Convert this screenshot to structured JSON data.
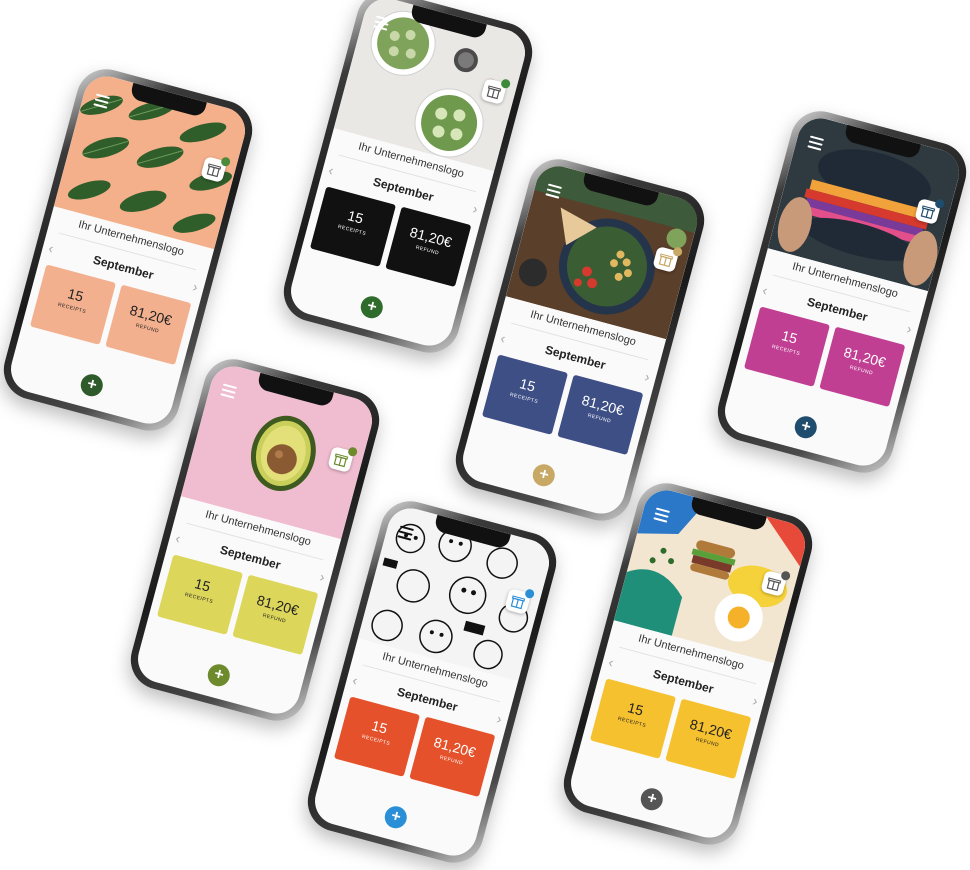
{
  "phones": [
    {
      "id": "kale",
      "hero": "kale-leaves-on-peach",
      "logo_text": "Ihr Unternehmenslogo",
      "month": "September",
      "receipts_value": "15",
      "receipts_label": "RECEIPTS",
      "refund_value": "81,20€",
      "refund_label": "REFUND",
      "tile_color": "#f2b08e",
      "tile_text_color": "#222222",
      "add_button_color": "#2f5a2a",
      "badge_color": "#4b8a3a",
      "add_icon": "plus-icon",
      "prev_icon": "chevron-left-icon",
      "next_icon": "chevron-right-icon",
      "menu_icon": "menu-icon",
      "gift_icon": "gift-icon"
    },
    {
      "id": "salad-bowls",
      "hero": "cucumber-salad-bowls",
      "logo_text": "Ihr Unternehmenslogo",
      "month": "September",
      "receipts_value": "15",
      "receipts_label": "RECEIPTS",
      "refund_value": "81,20€",
      "refund_label": "REFUND",
      "tile_color": "#111111",
      "tile_text_color": "#ffffff",
      "add_button_color": "#2f6b2a",
      "badge_color": "#3e8a3a",
      "add_icon": "plus-icon",
      "prev_icon": "chevron-left-icon",
      "next_icon": "chevron-right-icon",
      "menu_icon": "menu-icon",
      "gift_icon": "gift-icon"
    },
    {
      "id": "chickpea-bowl",
      "hero": "chickpea-salad-bowl",
      "logo_text": "Ihr Unternehmenslogo",
      "month": "September",
      "receipts_value": "15",
      "receipts_label": "RECEIPTS",
      "refund_value": "81,20€",
      "refund_label": "REFUND",
      "tile_color": "#3e4f86",
      "tile_text_color": "#ffffff",
      "add_button_color": "#c7a865",
      "badge_color": "#c7a865",
      "add_icon": "plus-icon",
      "prev_icon": "chevron-left-icon",
      "next_icon": "chevron-right-icon",
      "menu_icon": "menu-icon",
      "gift_icon": "gift-icon"
    },
    {
      "id": "burger",
      "hero": "black-bun-burger",
      "logo_text": "Ihr Unternehmenslogo",
      "month": "September",
      "receipts_value": "15",
      "receipts_label": "RECEIPTS",
      "refund_value": "81,20€",
      "refund_label": "REFUND",
      "tile_color": "#c13f93",
      "tile_text_color": "#ffffff",
      "add_button_color": "#1f4d6e",
      "badge_color": "#1f4d6e",
      "add_icon": "plus-icon",
      "prev_icon": "chevron-left-icon",
      "next_icon": "chevron-right-icon",
      "menu_icon": "menu-icon",
      "gift_icon": "gift-icon"
    },
    {
      "id": "avocado",
      "hero": "avocado-on-pink",
      "logo_text": "Ihr Unternehmenslogo",
      "month": "September",
      "receipts_value": "15",
      "receipts_label": "RECEIPTS",
      "refund_value": "81,20€",
      "refund_label": "REFUND",
      "tile_color": "#dcd65a",
      "tile_text_color": "#222222",
      "add_button_color": "#6d8a2c",
      "badge_color": "#6d8a2c",
      "add_icon": "plus-icon",
      "prev_icon": "chevron-left-icon",
      "next_icon": "chevron-right-icon",
      "menu_icon": "menu-icon",
      "gift_icon": "gift-icon"
    },
    {
      "id": "doodle",
      "hero": "black-white-doodle",
      "logo_text": "Ihr Unternehmenslogo",
      "month": "September",
      "receipts_value": "15",
      "receipts_label": "RECEIPTS",
      "refund_value": "81,20€",
      "refund_label": "REFUND",
      "tile_color": "#e4512a",
      "tile_text_color": "#ffffff",
      "add_button_color": "#2a8fd6",
      "badge_color": "#2a8fd6",
      "add_icon": "plus-icon",
      "prev_icon": "chevron-left-icon",
      "next_icon": "chevron-right-icon",
      "menu_icon": "menu-icon",
      "gift_icon": "gift-icon"
    },
    {
      "id": "colorful-food",
      "hero": "colorful-burger-egg-illustration",
      "logo_text": "Ihr Unternehmenslogo",
      "month": "September",
      "receipts_value": "15",
      "receipts_label": "RECEIPTS",
      "refund_value": "81,20€",
      "refund_label": "REFUND",
      "tile_color": "#f6c12e",
      "tile_text_color": "#222222",
      "add_button_color": "#555555",
      "badge_color": "#555555",
      "add_icon": "plus-icon",
      "prev_icon": "chevron-left-icon",
      "next_icon": "chevron-right-icon",
      "menu_icon": "menu-icon",
      "gift_icon": "gift-icon"
    }
  ]
}
